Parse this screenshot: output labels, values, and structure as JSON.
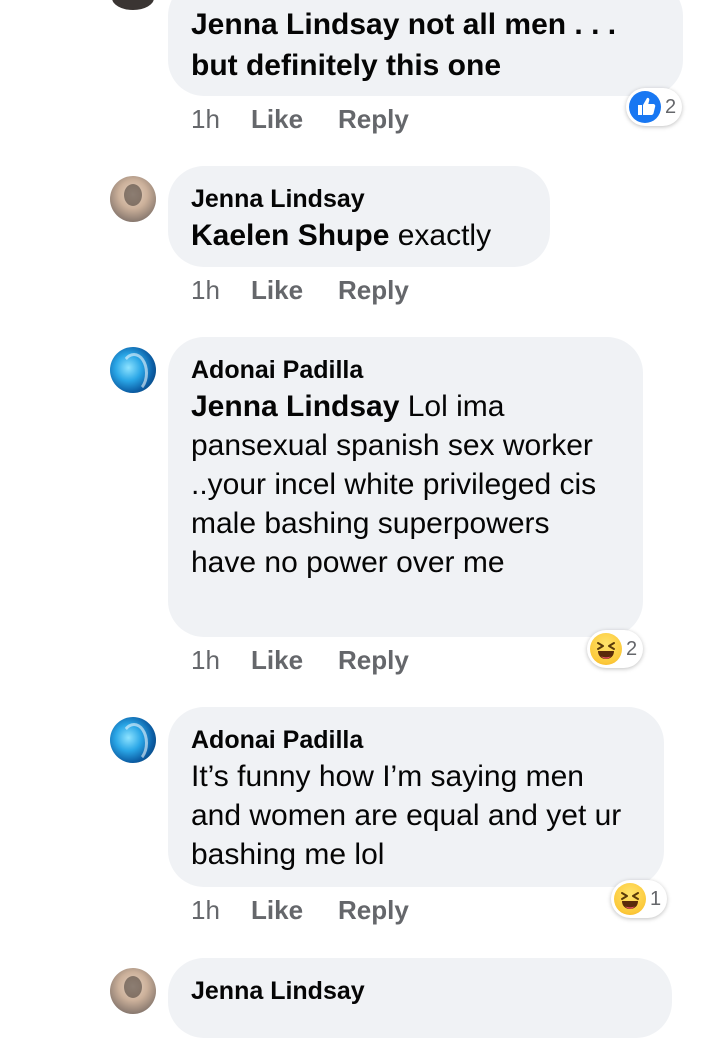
{
  "comments": [
    {
      "author": "",
      "mention": "Jenna Lindsay",
      "text": " not all men . . . but definitely this one",
      "time": "1h",
      "like_label": "Like",
      "reply_label": "Reply",
      "reaction": {
        "type": "like",
        "count": "2"
      }
    },
    {
      "author": "Jenna Lindsay",
      "mention": "Kaelen Shupe",
      "text": " exactly",
      "time": "1h",
      "like_label": "Like",
      "reply_label": "Reply"
    },
    {
      "author": "Adonai Padilla",
      "mention": "Jenna Lindsay",
      "text": " Lol ima pansexual spanish sex worker ..your incel white privileged cis male bashing superpowers have no power over me",
      "time": "1h",
      "like_label": "Like",
      "reply_label": "Reply",
      "reaction": {
        "type": "haha",
        "count": "2"
      }
    },
    {
      "author": "Adonai Padilla",
      "mention": "",
      "text": "It’s funny how I’m saying men and women are equal and yet ur bashing me lol",
      "time": "1h",
      "like_label": "Like",
      "reply_label": "Reply",
      "reaction": {
        "type": "haha",
        "count": "1"
      }
    },
    {
      "author": "Jenna Lindsay"
    }
  ],
  "colors": {
    "bubble": "#f0f2f5",
    "action_text": "#65676b",
    "like_blue": "#1877f2",
    "haha_yellow": "#fcc93a"
  },
  "icons": [
    "like-reaction-icon",
    "haha-reaction-icon"
  ]
}
